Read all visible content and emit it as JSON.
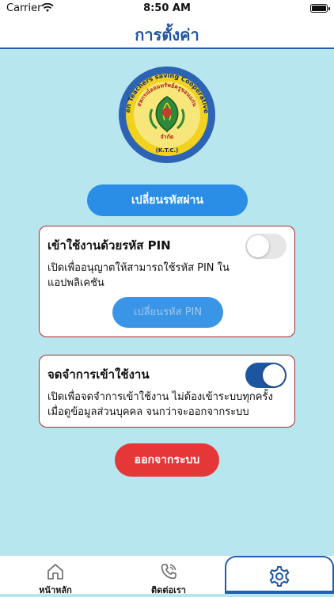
{
  "status_bar": {
    "carrier": "Carrier",
    "time": "8:50 AM"
  },
  "header": {
    "title": "การตั้งค่า"
  },
  "logo": {
    "text_top": "Khon Kaen Teachers saving Cooperative Limited",
    "text_thai": "สหกรณ์ออมทรัพย์ครูขอนแก่น",
    "text_center": "จำกัด",
    "text_bottom": "(K.T.C.)"
  },
  "actions": {
    "change_password": "เปลี่ยนรหัสผ่าน",
    "logout": "ออกจากระบบ"
  },
  "pin_card": {
    "title": "เข้าใช้งานด้วยรหัส PIN",
    "description": "เปิดเพื่ออนุญาตให้สามารถใช้รหัส PIN ใน แอปพลิเคชัน",
    "change_pin": "เปลี่ยนรหัส PIN",
    "enabled": false
  },
  "remember_card": {
    "title": "จดจำการเข้าใช้งาน",
    "description": "เปิดเพื่อจดจำการเข้าใช้งาน ไม่ต้องเข้าระบบทุกครั้งเมื่อดูข้อมูลส่วนบุคคล จนกว่าจะออกจากระบบ",
    "enabled": true
  },
  "tabbar": {
    "home": "หน้าหลัก",
    "contact": "ติดต่อเรา",
    "settings_icon": "gear-icon"
  },
  "colors": {
    "background": "#b7e6ee",
    "primary": "#1e55a0",
    "button_blue": "#2a8ee6",
    "danger": "#e53737"
  }
}
